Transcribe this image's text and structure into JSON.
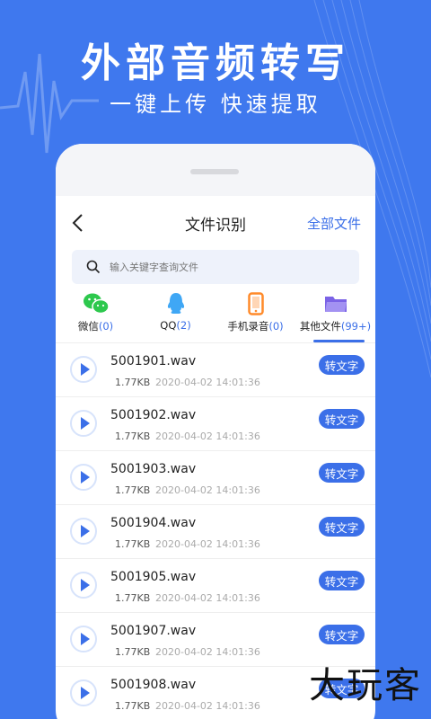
{
  "hero": {
    "title": "外部音频转写",
    "subtitle": "一键上传 快速提取"
  },
  "nav": {
    "title": "文件识别",
    "right_link": "全部文件"
  },
  "search": {
    "placeholder": "输入关键字查询文件"
  },
  "categories": [
    {
      "label": "微信",
      "count": "(0)",
      "icon": "wechat-icon",
      "color": "#2dc84d"
    },
    {
      "label": "QQ",
      "count": "(2)",
      "icon": "qq-icon",
      "color": "#3fa7f5"
    },
    {
      "label": "手机录音",
      "count": "(0)",
      "icon": "phone-record-icon",
      "color": "#ff8a2a"
    },
    {
      "label": "其他文件",
      "count": "(99+)",
      "icon": "folder-icon",
      "color": "#7b63e6",
      "active": true
    }
  ],
  "files": [
    {
      "name": "5001901.wav",
      "size": "1.77KB",
      "date": "2020-04-02 14:01:36",
      "action": "转文字"
    },
    {
      "name": "5001902.wav",
      "size": "1.77KB",
      "date": "2020-04-02 14:01:36",
      "action": "转文字"
    },
    {
      "name": "5001903.wav",
      "size": "1.77KB",
      "date": "2020-04-02 14:01:36",
      "action": "转文字"
    },
    {
      "name": "5001904.wav",
      "size": "1.77KB",
      "date": "2020-04-02 14:01:36",
      "action": "转文字"
    },
    {
      "name": "5001905.wav",
      "size": "1.77KB",
      "date": "2020-04-02 14:01:36",
      "action": "转文字"
    },
    {
      "name": "5001907.wav",
      "size": "1.77KB",
      "date": "2020-04-02 14:01:36",
      "action": "转文字"
    },
    {
      "name": "5001908.wav",
      "size": "1.77KB",
      "date": "2020-04-02 14:01:36",
      "action": "转文字"
    }
  ],
  "watermark": "大玩客",
  "colors": {
    "background": "#3f78ee",
    "accent": "#3b6fe8"
  }
}
